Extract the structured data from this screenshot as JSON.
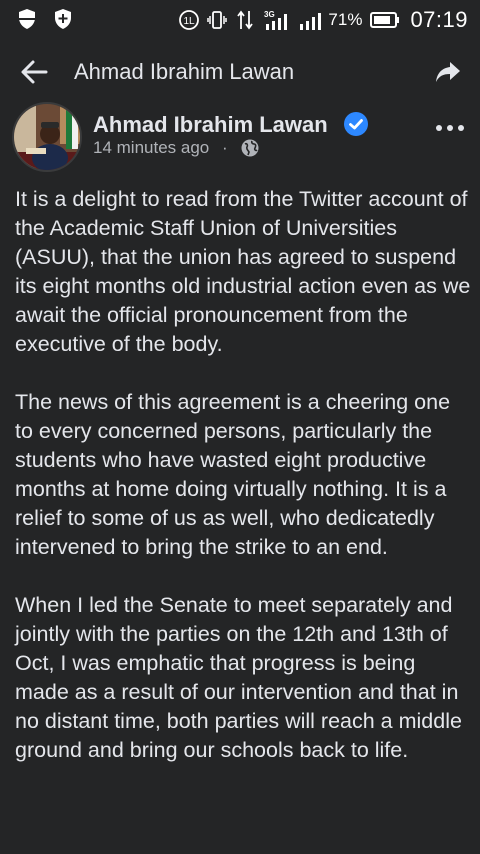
{
  "status_bar": {
    "battery_percent": "71%",
    "time": "07:19",
    "network": "3G"
  },
  "app_bar": {
    "title": "Ahmad Ibrahim Lawan"
  },
  "post": {
    "author": "Ahmad Ibrahim Lawan",
    "timestamp": "14 minutes ago",
    "separator": "·",
    "verified": true,
    "privacy_icon": "globe-icon",
    "paragraphs": [
      "It is a delight to read from the Twitter account of the Academic Staff Union of Universities (ASUU), that the union has agreed to suspend its eight months old industrial action even as we await the official pronouncement from the executive of the body.",
      "The news of this agreement is a cheering one to every concerned persons, particularly the students who have wasted eight productive months at home doing virtually nothing. It is a relief to some of us as well, who dedicatedly intervened to bring the strike to an end.",
      "When I led the Senate to meet separately and jointly with the parties on the 12th and 13th of Oct, I was emphatic that progress is being made as a result of our intervention and that in no distant time, both parties will reach a middle ground and bring our schools back to life."
    ]
  },
  "colors": {
    "background": "#242526",
    "text": "#e4e6eb",
    "secondary_text": "#b0b3b8",
    "verified_blue": "#2d88ff"
  }
}
